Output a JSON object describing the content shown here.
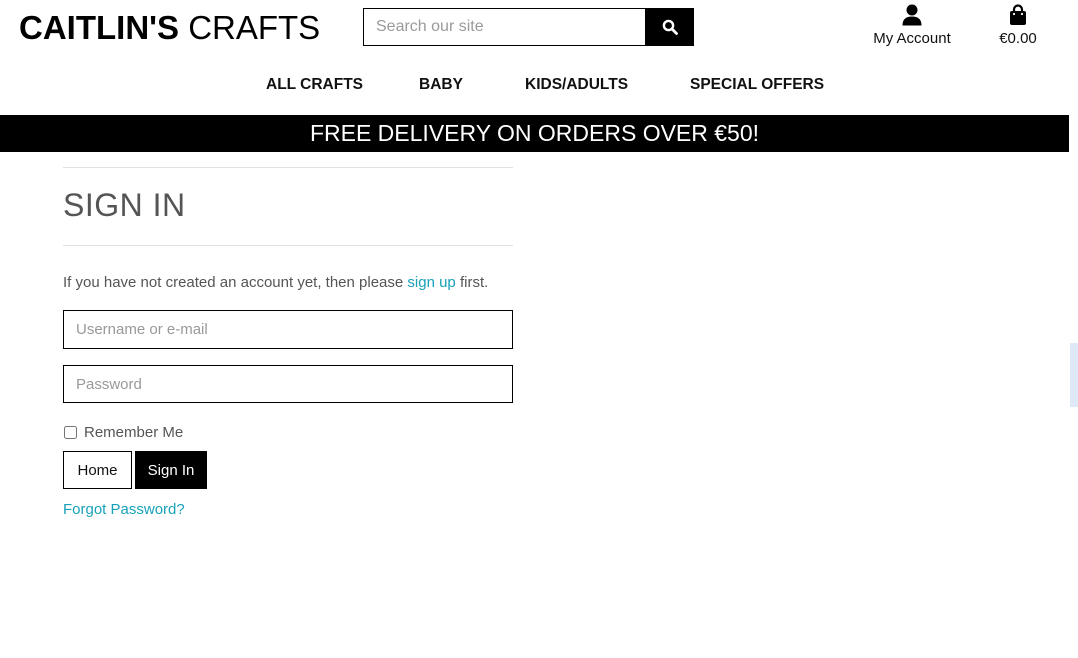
{
  "header": {
    "logo_bold": "CAITLIN'S",
    "logo_light": "CRAFTS",
    "search_placeholder": "Search our site",
    "search_icon": "search-icon",
    "account_label": "My Account",
    "account_icon": "user-icon",
    "bag_label": "€0.00",
    "bag_icon": "shopping-bag-icon"
  },
  "nav": {
    "items": [
      {
        "label": "ALL CRAFTS"
      },
      {
        "label": "BABY"
      },
      {
        "label": "KIDS/ADULTS"
      },
      {
        "label": "SPECIAL OFFERS"
      }
    ]
  },
  "banner": {
    "text": "FREE DELIVERY ON ORDERS OVER €50!"
  },
  "signin": {
    "title": "SIGN IN",
    "intro_before": "If you have not created an account yet, then please ",
    "intro_link": "sign up",
    "intro_after": " first.",
    "username_placeholder": "Username or e-mail",
    "password_placeholder": "Password",
    "remember_label": "Remember Me",
    "home_button": "Home",
    "signin_button": "Sign In",
    "forgot_link": "Forgot Password?"
  },
  "colors": {
    "accent_link": "#17a2b8",
    "banner_bg": "#000000",
    "primary_button": "#000000"
  }
}
